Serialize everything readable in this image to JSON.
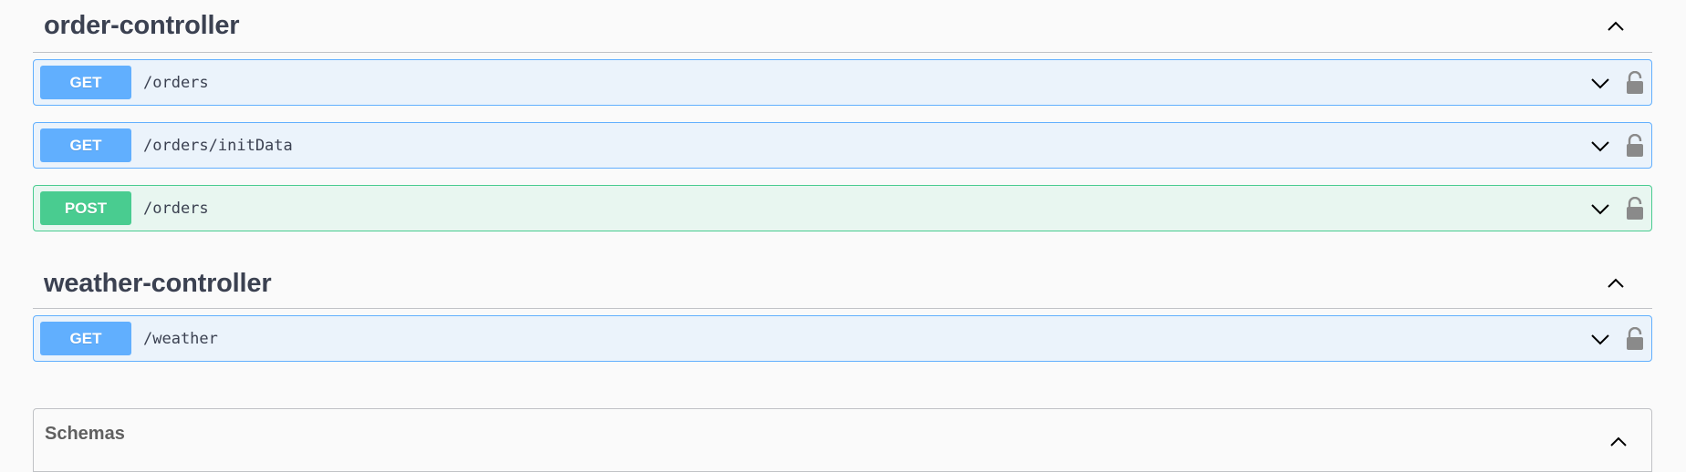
{
  "tags": [
    {
      "name": "order-controller",
      "operations": [
        {
          "method": "GET",
          "path": "/orders"
        },
        {
          "method": "GET",
          "path": "/orders/initData"
        },
        {
          "method": "POST",
          "path": "/orders"
        }
      ]
    },
    {
      "name": "weather-controller",
      "operations": [
        {
          "method": "GET",
          "path": "/weather"
        }
      ]
    }
  ],
  "schemas": {
    "title": "Schemas"
  },
  "colors": {
    "get": "#61affe",
    "post": "#49cc90",
    "get_bg": "#ebf3fb",
    "post_bg": "#e8f6f0"
  },
  "icons": {
    "collapse": "chevron-up-icon",
    "expand": "chevron-down-icon",
    "auth": "lock-icon"
  }
}
